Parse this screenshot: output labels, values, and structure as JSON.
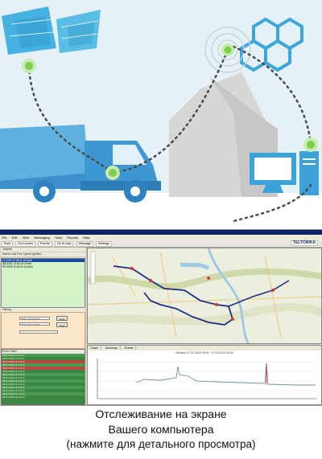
{
  "caption": {
    "line1": "Отслеживание на экране",
    "line2": "Вашего компьютера",
    "line3": "(нажмите для детального просмотра)"
  },
  "app": {
    "menu": [
      "File",
      "Edit",
      "View",
      "Messaging",
      "Tools",
      "Reports",
      "Help"
    ],
    "toolbar": [
      "Track",
      "Geo-zones",
      "Events",
      "Go to map",
      "Message",
      "Settings"
    ],
    "brand": "TELTONIKA",
    "left_panel_header": "Objects",
    "objects_header": "Name  Last Pos  Speed  Ignition",
    "vehicle_rows": [
      "LY-1204   12:45:31  54 km/h",
      "AB-2201   12:44:10  0 km/h",
      "KP-0978   12:40:02  61 km/h"
    ],
    "history_header": "History",
    "from_value": "07.01.2013 09:00",
    "to_value": "07.01.2013 18:00",
    "apply_label": "Apply",
    "clear_label": "Clear",
    "sensors_header": "Sensor  Value",
    "graph_tabs": [
      "Graph",
      "Summary",
      "Events"
    ],
    "graph_title": "Sensors 07.01.2013 09:00 - 07.01.2013 18:00"
  },
  "colors": {
    "sky": "#e9f3f8",
    "blue": "#48b4e0",
    "dark_blue": "#2a7fbf",
    "green_dot": "#8cd25a",
    "grey": "#d6d6d6",
    "route": "#1f2f8a"
  }
}
